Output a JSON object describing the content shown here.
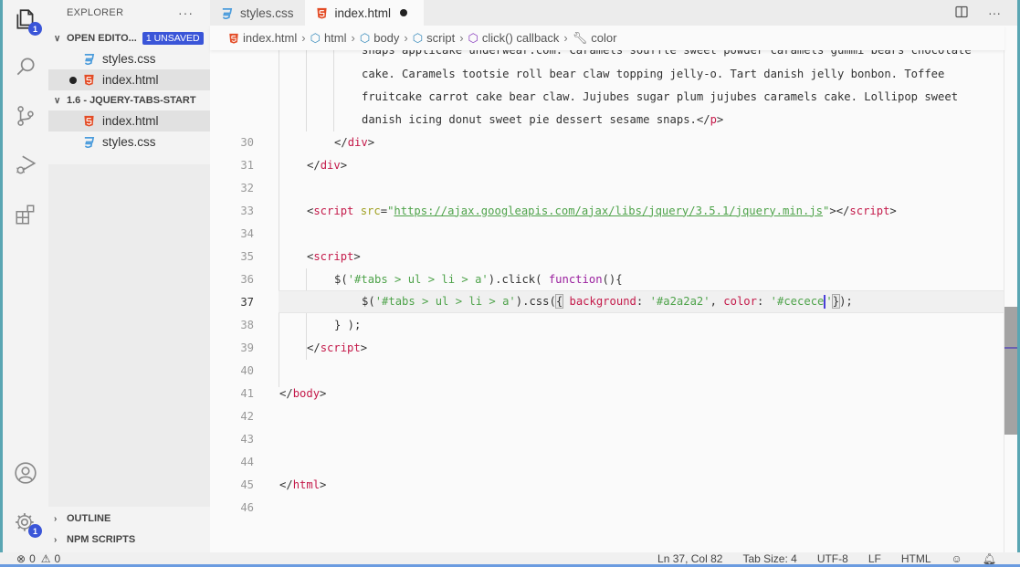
{
  "activity_bar": {
    "items": [
      {
        "icon": "files-icon",
        "badge": "1"
      },
      {
        "icon": "search-icon"
      },
      {
        "icon": "source-control-icon"
      },
      {
        "icon": "run-debug-icon"
      },
      {
        "icon": "extensions-icon"
      }
    ],
    "bottom": [
      {
        "icon": "account-icon"
      },
      {
        "icon": "settings-gear-icon",
        "badge": "1"
      }
    ]
  },
  "sidebar": {
    "title": "EXPLORER",
    "more": "···",
    "open_editors": {
      "title": "OPEN EDITO...",
      "badge": "1 UNSAVED",
      "files": [
        {
          "name": "styles.css",
          "type": "css",
          "dirty": false
        },
        {
          "name": "index.html",
          "type": "html",
          "dirty": true
        }
      ]
    },
    "folder": {
      "title": "1.6 - JQUERY-TABS-START",
      "files": [
        {
          "name": "index.html",
          "type": "html"
        },
        {
          "name": "styles.css",
          "type": "css"
        }
      ]
    },
    "outline": "OUTLINE",
    "npm_scripts": "NPM SCRIPTS"
  },
  "tabs": [
    {
      "label": "styles.css",
      "type": "css",
      "active": false
    },
    {
      "label": "index.html",
      "type": "html",
      "active": true,
      "dirty": true
    }
  ],
  "breadcrumb": [
    {
      "label": "index.html",
      "icon": "html-file-icon"
    },
    {
      "label": "html",
      "icon": "element-icon"
    },
    {
      "label": "body",
      "icon": "element-icon"
    },
    {
      "label": "script",
      "icon": "element-icon"
    },
    {
      "label": "click() callback",
      "icon": "method-icon"
    },
    {
      "label": "color",
      "icon": "wrench-icon"
    }
  ],
  "code": {
    "wrapped_lines": [
      "snaps applicake underwear.com. Caramels soufflé sweet powder caramels gummi bears chocolate",
      "cake. Caramels tootsie roll bear claw topping jelly-o. Tart danish jelly bonbon. Toffee",
      "fruitcake carrot cake bear claw. Jujubes sugar plum jujubes caramels cake. Lollipop sweet",
      "danish icing donut sweet pie dessert sesame snaps."
    ],
    "line_numbers": [
      "30",
      "31",
      "32",
      "33",
      "34",
      "35",
      "36",
      "37",
      "38",
      "39",
      "40",
      "41",
      "42",
      "43",
      "44",
      "45",
      "46"
    ],
    "current_line": "37",
    "script_src": "https://ajax.googleapis.com/ajax/libs/jquery/3.5.1/jquery.min.js",
    "selector": "'#tabs > ul > li > a'",
    "bg_value": "'#a2a2a2'",
    "color_value_start": "'#cecece",
    "color_value_end": "'"
  },
  "status_bar": {
    "errors": "0",
    "warnings": "0",
    "position": "Ln 37, Col 82",
    "tab_size": "Tab Size: 4",
    "encoding": "UTF-8",
    "eol": "LF",
    "language": "HTML"
  }
}
